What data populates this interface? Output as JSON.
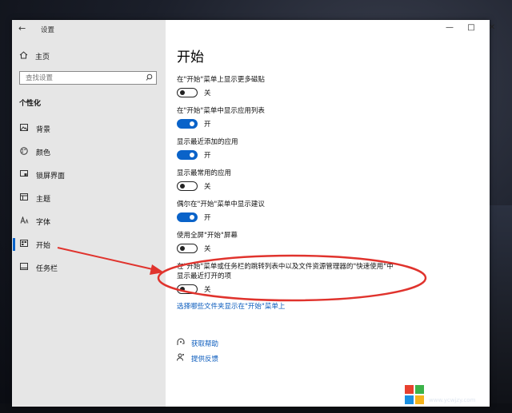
{
  "window": {
    "title": "设置",
    "controls": {
      "minimize": "—",
      "maximize": "□",
      "close": "✕"
    },
    "back_glyph": "←"
  },
  "sidebar": {
    "home": "主页",
    "search_placeholder": "查找设置",
    "section": "个性化",
    "items": [
      {
        "label": "背景",
        "icon": "background-image-icon"
      },
      {
        "label": "颜色",
        "icon": "palette-icon"
      },
      {
        "label": "锁屏界面",
        "icon": "lock-screen-icon"
      },
      {
        "label": "主题",
        "icon": "theme-icon"
      },
      {
        "label": "字体",
        "icon": "font-icon"
      },
      {
        "label": "开始",
        "icon": "start-icon",
        "selected": true
      },
      {
        "label": "任务栏",
        "icon": "taskbar-icon"
      }
    ]
  },
  "main": {
    "title": "开始",
    "settings": [
      {
        "label": "在\"开始\"菜单上显示更多磁贴",
        "state": "关",
        "on": false
      },
      {
        "label": "在\"开始\"菜单中显示应用列表",
        "state": "开",
        "on": true
      },
      {
        "label": "显示最近添加的应用",
        "state": "开",
        "on": true
      },
      {
        "label": "显示最常用的应用",
        "state": "关",
        "on": false
      },
      {
        "label": "偶尔在\"开始\"菜单中显示建议",
        "state": "开",
        "on": true
      },
      {
        "label": "使用全屏\"开始\"屏幕",
        "state": "关",
        "on": false
      },
      {
        "label_line1": "在\"开始\"菜单或任务栏的跳转列表中以及文件资源管理器的\"快速使用\"中",
        "label_line2": "显示最近打开的项",
        "state": "关",
        "on": false
      }
    ],
    "folders_link": "选择哪些文件夹显示在\"开始\"菜单上",
    "help": "获取帮助",
    "feedback": "提供反馈"
  },
  "annotation": {
    "color": "#e0332d"
  },
  "watermark": {
    "title": "纯净系统之家",
    "url": "www.ycwjzy.com",
    "logo_colors": [
      "#e8402e",
      "#3cb34a",
      "#1a8fe0",
      "#f5b31b"
    ]
  },
  "colors": {
    "accent": "#0a63c9",
    "sidebar_bg": "#e6e6e6"
  }
}
